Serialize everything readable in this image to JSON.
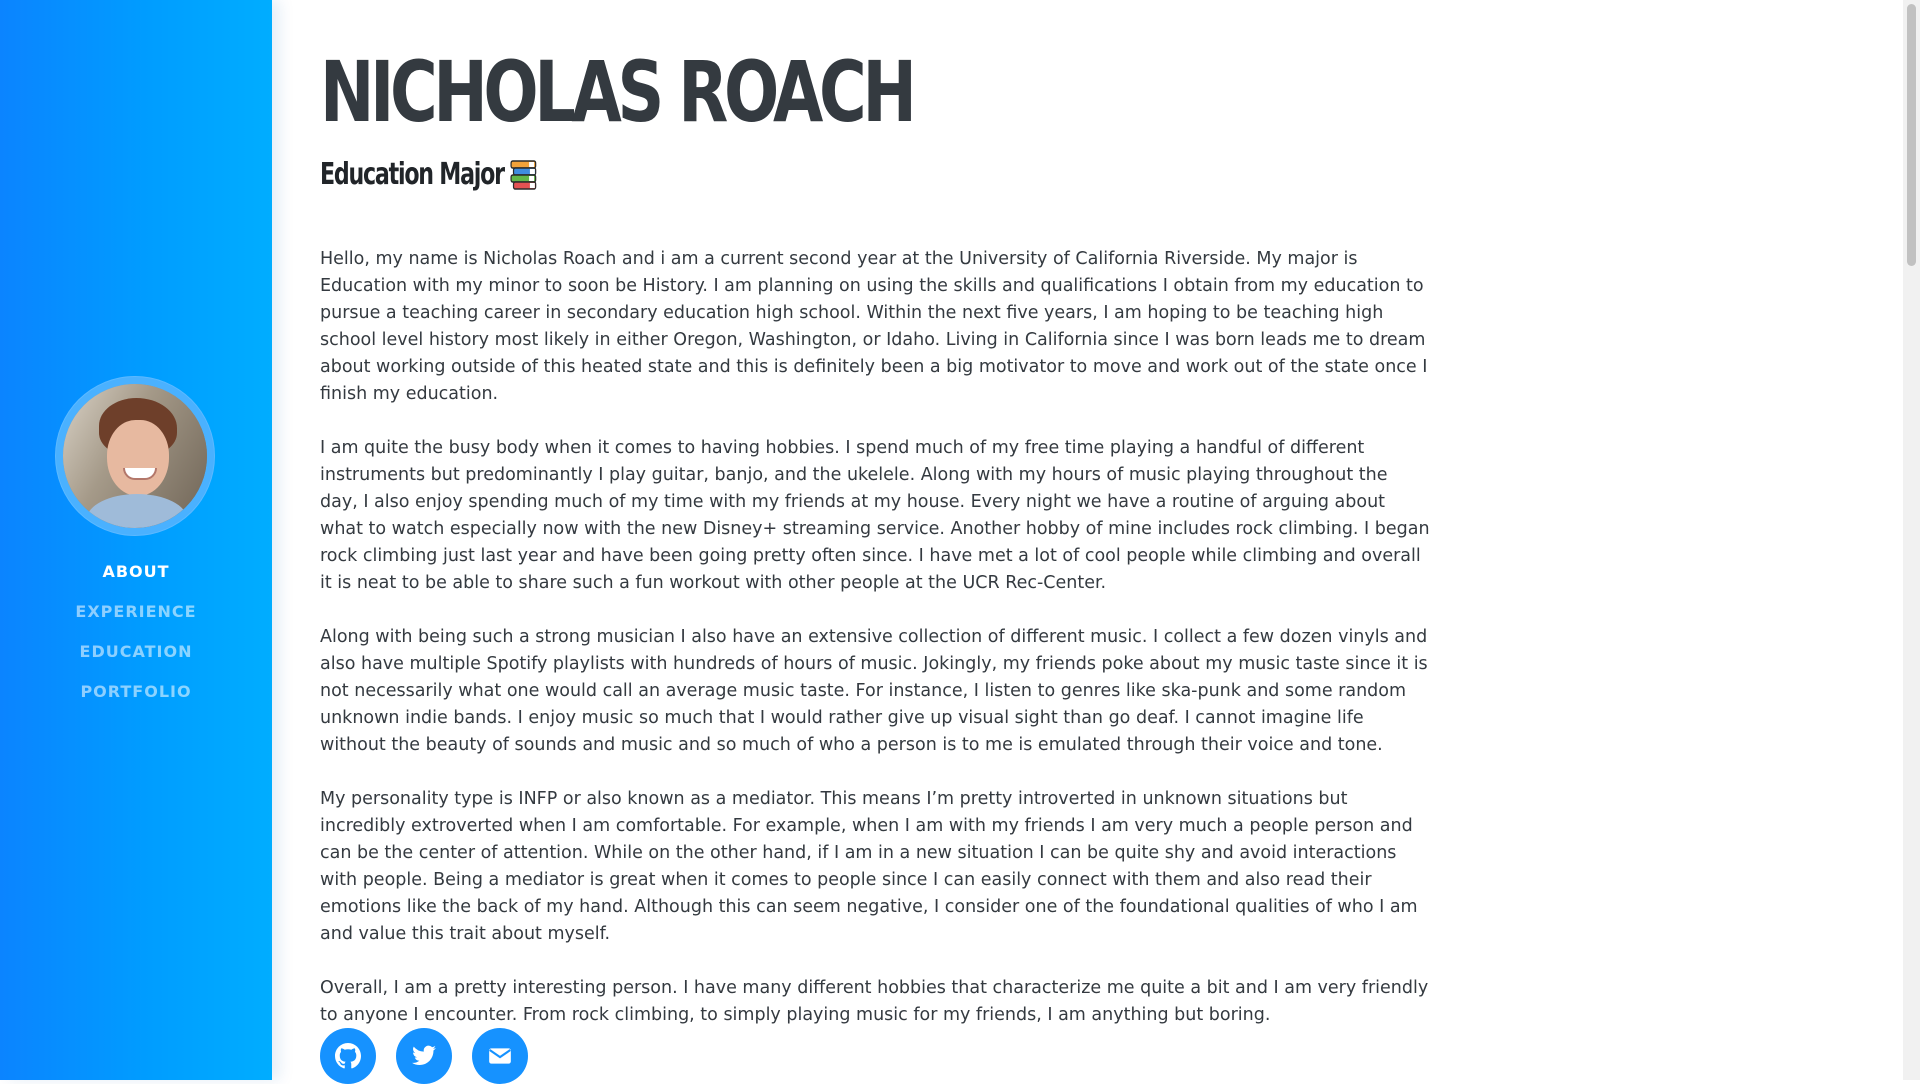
{
  "profile": {
    "name": "NICHOLAS ROACH",
    "subtitle": "Education Major",
    "subtitle_icon": "books-emoji-icon",
    "avatar_alt": "avatar"
  },
  "nav": [
    {
      "label": "About",
      "active": true
    },
    {
      "label": "Experience",
      "active": false
    },
    {
      "label": "Education",
      "active": false
    },
    {
      "label": "Portfolio",
      "active": false
    }
  ],
  "bio": [
    "Hello, my name is Nicholas Roach and i am a current second year at the University of California Riverside. My major is Education with my minor to soon be History. I am planning on using the skills and qualifications I obtain from my education to pursue a teaching career in secondary education high school. Within the next five years, I am hoping to be teaching high school level history most likely in either Oregon, Washington, or Idaho. Living in California since I was born leads me to dream about working outside of this heated state and this is definitely been a big motivator to move and work out of the state once I finish my education.",
    "I am quite the busy body when it comes to having hobbies. I spend much of my free time playing a handful of different instruments but predominantly I play guitar, banjo, and the ukelele. Along with my hours of music playing throughout the day, I also enjoy spending much of my time with my friends at my house. Every night we have a routine of arguing about what to watch especially now with the new Disney+ streaming service. Another hobby of mine includes rock climbing. I began rock climbing just last year and have been going pretty often since. I have met a lot of cool people while climbing and overall it is neat to be able to share such a fun workout with other people at the UCR Rec-Center.",
    "Along with being such a strong musician I also have an extensive collection of different music. I collect a few dozen vinyls and also have multiple Spotify playlists with hundreds of hours of music. Jokingly, my friends poke about my music taste since it is not necessarily what one would call an average music taste. For instance, I listen to genres like ska-punk and some random unknown indie bands. I enjoy music so much that I would rather give up visual sight than go deaf. I cannot imagine life without the beauty of sounds and music and so much of who a person is to me is emulated through their voice and tone.",
    "My personality type is INFP or also known as a mediator. This means I’m pretty introverted in unknown situations but incredibly extroverted when I am comfortable. For example, when I am with my friends I am very much a people person and can be the center of attention. While on the other hand, if I am in a new situation I can be quite shy and avoid interactions with people. Being a mediator is great when it comes to people since I can easily connect with them and also read their emotions like the back of my hand. Although this can seem negative, I consider one of the foundational qualities of who I am and value this trait about myself.",
    "Overall, I am a pretty interesting person. I have many different hobbies that characterize me quite a bit and I am very friendly to anyone I encounter. From rock climbing, to simply playing music for my friends, I am anything but boring."
  ],
  "social": [
    {
      "icon": "github-icon"
    },
    {
      "icon": "twitter-icon"
    },
    {
      "icon": "email-icon"
    }
  ],
  "colors": {
    "sidebar_start": "#0b84ff",
    "sidebar_end": "#00adff",
    "accent": "#1692ff",
    "text": "#343a40"
  }
}
